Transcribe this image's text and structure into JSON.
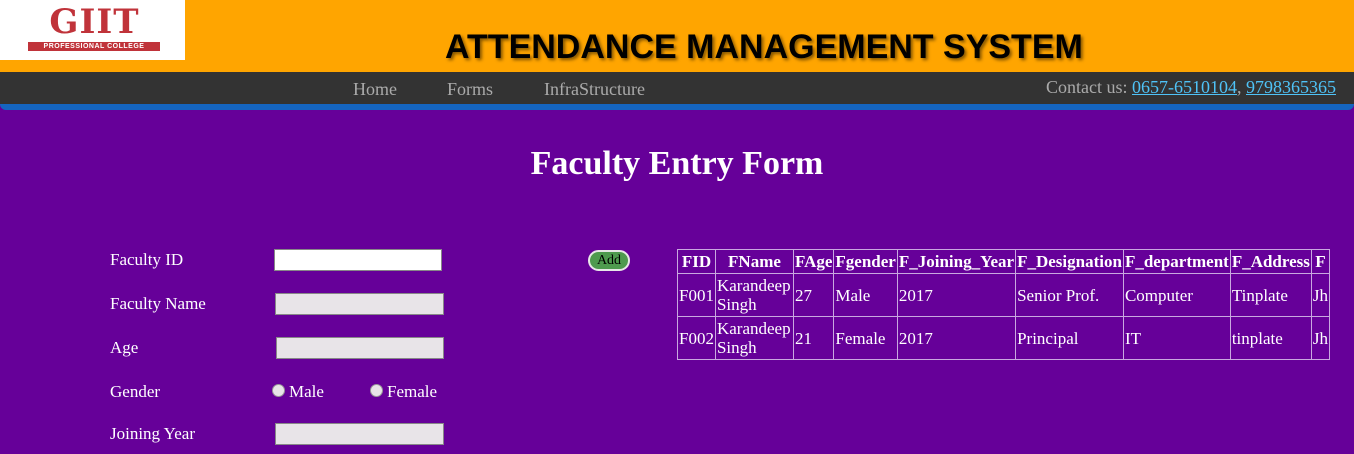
{
  "logo": {
    "text": "GIIT",
    "subtext": "PROFESSIONAL COLLEGE"
  },
  "site_title": "ATTENDANCE MANAGEMENT SYSTEM",
  "nav": {
    "items": [
      "Home",
      "Forms",
      "InfraStructure"
    ]
  },
  "contact": {
    "label": "Contact us:",
    "phone1": "0657-6510104",
    "separator": ",",
    "phone2": "9798365365"
  },
  "colors": {
    "page_bg": "#660099",
    "header_bg": "#ffa500",
    "nav_bg": "#333333",
    "nav_accent": "#1565c0",
    "link": "#4fc3f7",
    "add_button": "#4e9a4e"
  },
  "form": {
    "title": "Faculty Entry Form",
    "fields": {
      "faculty_id": {
        "label": "Faculty ID",
        "value": ""
      },
      "faculty_name": {
        "label": "Faculty Name",
        "value": ""
      },
      "age": {
        "label": "Age",
        "value": ""
      },
      "gender": {
        "label": "Gender",
        "options": [
          "Male",
          "Female"
        ]
      },
      "joining_year": {
        "label": "Joining Year",
        "value": ""
      }
    },
    "add_label": "Add"
  },
  "table": {
    "headers": [
      "FID",
      "FName",
      "FAge",
      "Fgender",
      "F_Joining_Year",
      "F_Designation",
      "F_department",
      "F_Address",
      "F"
    ],
    "rows": [
      [
        "F001",
        "Karandeep Singh",
        "27",
        "Male",
        "2017",
        "Senior Prof.",
        "Computer",
        "Tinplate",
        "Jh"
      ],
      [
        "F002",
        "Karandeep Singh",
        "21",
        "Female",
        "2017",
        "Principal",
        "IT",
        "tinplate",
        "Jh"
      ]
    ]
  }
}
